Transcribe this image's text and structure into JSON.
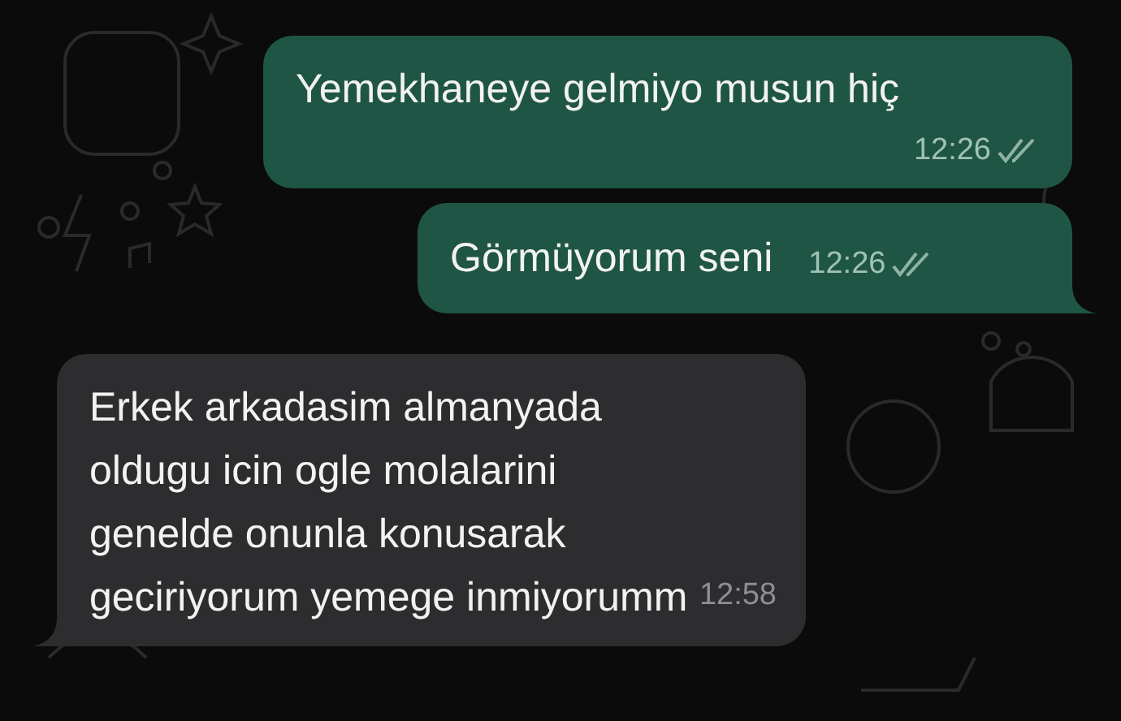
{
  "messages": [
    {
      "kind": "outgoing",
      "text": "Yemekhaneye gelmiyo musun hiç",
      "time": "12:26",
      "read": false,
      "tail": false
    },
    {
      "kind": "outgoing",
      "text": "Görmüyorum seni",
      "time": "12:26",
      "read": false,
      "tail": true
    },
    {
      "kind": "incoming",
      "text": "Erkek arkadasim almanyada oldugu icin ogle molalarini genelde onunla konusarak geciriyorum yemege inmiyorumm",
      "time": "12:58",
      "tail": true
    }
  ]
}
